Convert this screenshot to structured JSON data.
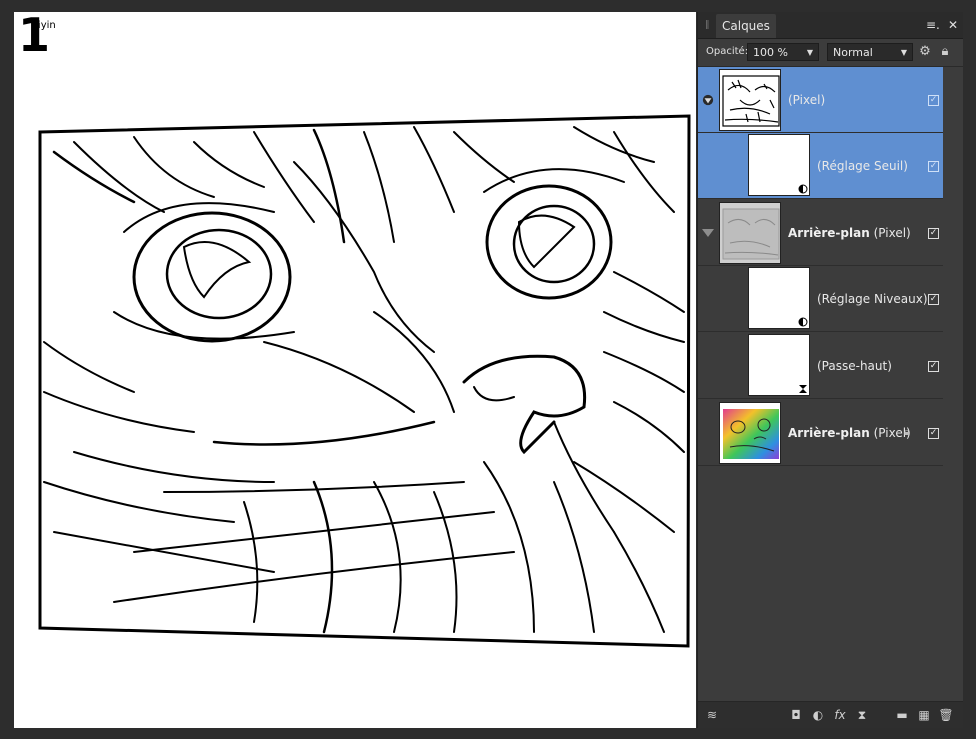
{
  "canvas": {
    "step_number": "1",
    "step_sub": "tiyin"
  },
  "panel": {
    "tab_label": "Calques",
    "menu_icon": "menu-icon",
    "close_icon": "close-icon",
    "opacity_label": "Opacité:",
    "opacity_value": "100 %",
    "blend_mode": "Normal",
    "layers": [
      {
        "name_bold": "",
        "name_type": "(Pixel)",
        "selected": true,
        "visible": true
      },
      {
        "name_bold": "",
        "name_type": "(Réglage Seuil)",
        "selected": true,
        "visible": true
      },
      {
        "name_bold": "Arrière-plan",
        "name_type": "(Pixel)",
        "selected": false,
        "visible": true
      },
      {
        "name_bold": "",
        "name_type": "(Réglage Niveaux)",
        "selected": false,
        "visible": true
      },
      {
        "name_bold": "",
        "name_type": "(Passe-haut)",
        "selected": false,
        "visible": true
      },
      {
        "name_bold": "Arrière-plan",
        "name_type": "(Pixel)",
        "selected": false,
        "visible": true,
        "locked": true
      }
    ],
    "footer_icons": [
      "layers-stack-icon",
      "mask-icon",
      "adjustment-icon",
      "fx-icon",
      "live-filter-icon",
      "folder-icon",
      "pixel-layer-icon",
      "trash-icon"
    ]
  }
}
